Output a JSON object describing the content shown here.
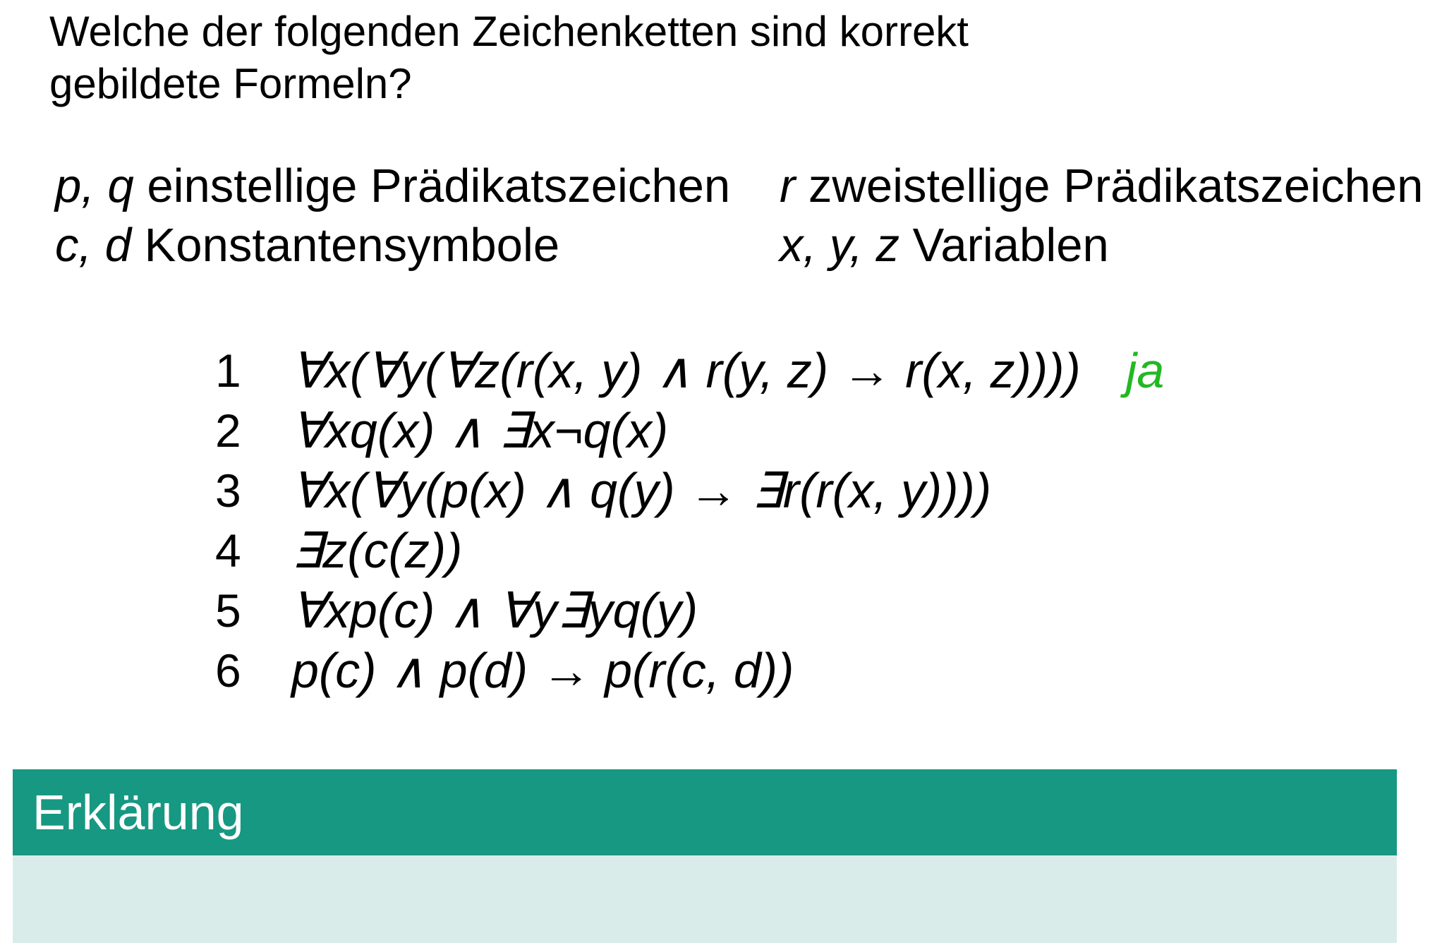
{
  "question": {
    "line1": "Welche der folgenden Zeichenketten sind korrekt",
    "line2": "gebildete Formeln?"
  },
  "signature": {
    "left": [
      {
        "symbols": "p, q",
        "description": " einstellige Prädikatszeichen"
      },
      {
        "symbols": "c, d",
        "description": " Konstantensymbole"
      }
    ],
    "right": [
      {
        "symbols": "r",
        "description": " zweistellige Prädikatszeichen"
      },
      {
        "symbols": "x, y, z",
        "description": " Variablen"
      }
    ]
  },
  "formulas": [
    {
      "number": "1",
      "expression": "∀x(∀y(∀z(r(x, y) ∧ r(y, z) → r(x, z))))",
      "answer": "ja"
    },
    {
      "number": "2",
      "expression": "∀xq(x) ∧ ∃x¬q(x)",
      "answer": ""
    },
    {
      "number": "3",
      "expression": "∀x(∀y(p(x) ∧ q(y) → ∃r(r(x, y))))",
      "answer": ""
    },
    {
      "number": "4",
      "expression": "∃z(c(z))",
      "answer": ""
    },
    {
      "number": "5",
      "expression": "∀xp(c) ∧ ∀y∃yq(y)",
      "answer": ""
    },
    {
      "number": "6",
      "expression": "p(c) ∧ p(d) → p(r(c, d))",
      "answer": ""
    }
  ],
  "panel": {
    "title": "Erklärung",
    "body": ""
  },
  "colors": {
    "panel_header": "#179882",
    "panel_body": "#d9ecea",
    "answer": "#22b822"
  }
}
